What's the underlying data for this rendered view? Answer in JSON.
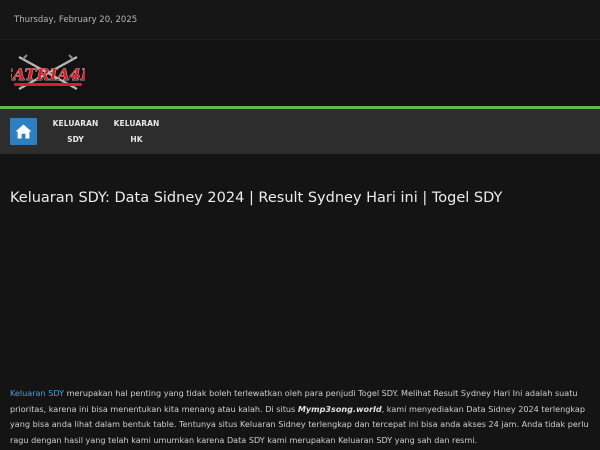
{
  "topbar": {
    "date": "Thursday, February 20, 2025"
  },
  "header": {
    "logo_text": "SATRIA4D"
  },
  "nav": {
    "home_icon": "home-icon",
    "items": [
      {
        "line1": "KELUARAN",
        "line2": "SDY"
      },
      {
        "line1": "KELUARAN",
        "line2": "HK"
      }
    ]
  },
  "article": {
    "title": "Keluaran SDY: Data Sidney 2024 | Result Sydney Hari ini | Togel SDY",
    "para": {
      "link": "Keluaran SDY",
      "text1": " merupakan hal penting yang tidak boleh terlewatkan oleh para penjudi Togel SDY. Melihat Result Sydney Hari Ini adalah suatu prioritas, karena ini bisa menentukan kita menang atau kalah. Di situs ",
      "site": "Mymp3song.world",
      "text2": ", kami menyediakan Data Sidney 2024 terlengkap yang bisa anda lihat dalam bentuk table. Tentunya situs Keluaran Sidney terlengkap dan tercepat ini bisa anda akses 24 jam. Anda tidak perlu ragu dengan hasil yang telah kami umumkan karena Data SDY kami merupakan Keluaran SDY yang sah dan resmi."
    }
  },
  "colors": {
    "accent_green": "#5dbb46",
    "home_blue": "#2f7fc0",
    "link_blue": "#4a9fdf",
    "logo_red": "#d4202a"
  }
}
